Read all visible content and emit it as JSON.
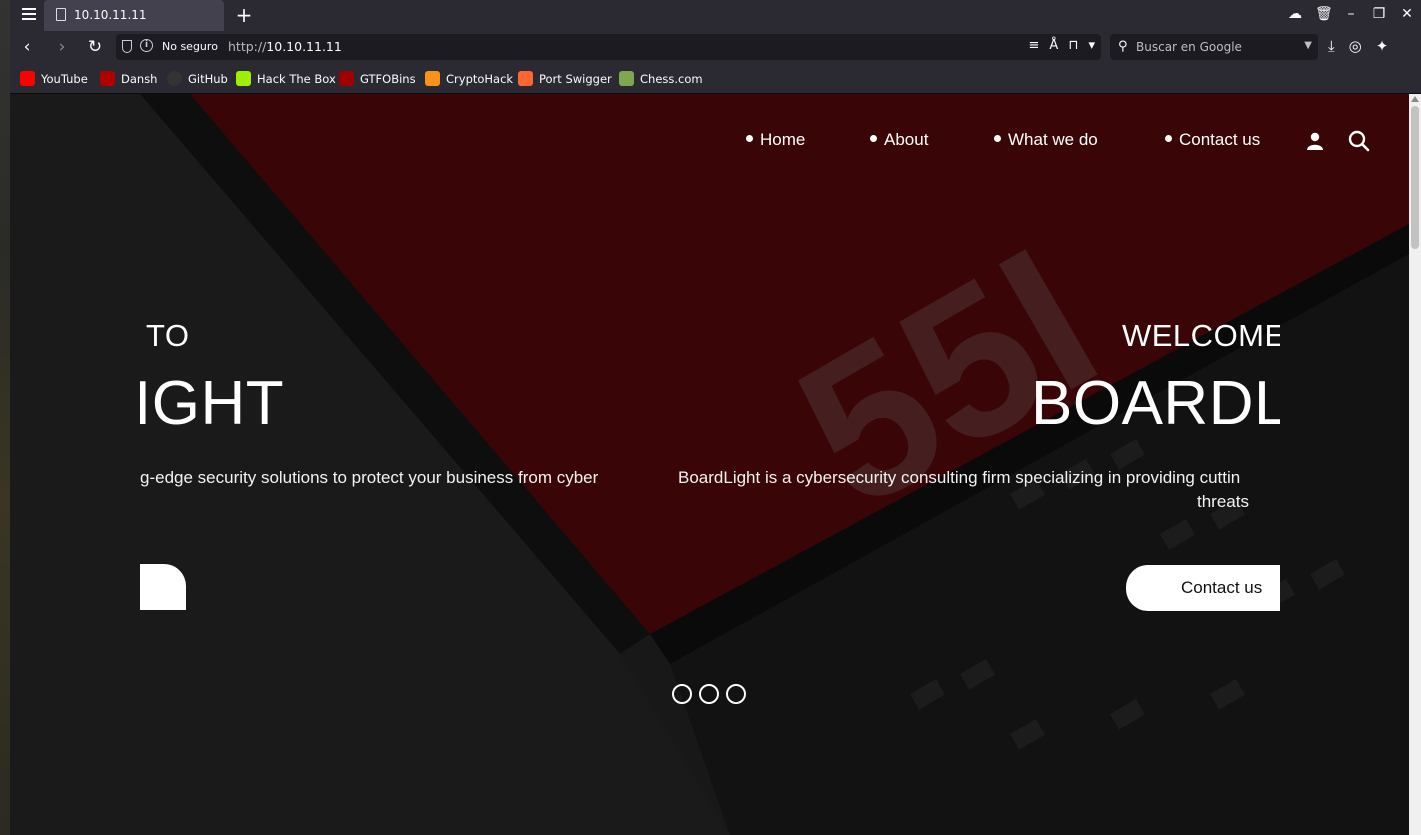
{
  "browser": {
    "tab_title": "10.10.11.11",
    "security_label": "No seguro",
    "url_scheme": "http://",
    "url_host": "10.10.11.11",
    "search_placeholder": "Buscar en Google"
  },
  "bookmarks": [
    {
      "label": "YouTube",
      "color": "#ff0000"
    },
    {
      "label": "Dansh",
      "color": "#b00000"
    },
    {
      "label": "GitHub",
      "color": "#333333"
    },
    {
      "label": "Hack The Box",
      "color": "#9fef00"
    },
    {
      "label": "GTFOBins",
      "color": "#a00000"
    },
    {
      "label": "CryptoHack",
      "color": "#f7931a"
    },
    {
      "label": "Port Swigger",
      "color": "#ff6633"
    },
    {
      "label": "Chess.com",
      "color": "#7fa650"
    }
  ],
  "site": {
    "nav": [
      "Home",
      "About",
      "What we do",
      "Contact us"
    ],
    "hero": {
      "left_subtitle_fragment": "TO",
      "left_title_fragment": "IGHT",
      "left_desc_fragment": "g-edge security solutions to protect your business from cyber",
      "right_subtitle": "WELCOME",
      "right_title_fragment": "BOARDL",
      "right_desc_line1": "BoardLight is a cybersecurity consulting firm specializing in providing cuttin",
      "right_desc_line2": "threats",
      "cta_label": "Contact us"
    },
    "slider_dots": 3,
    "bg_mark": "55I"
  },
  "colors": {
    "hero_red": "#3a0507",
    "page_dark": "#1a1a1a"
  }
}
